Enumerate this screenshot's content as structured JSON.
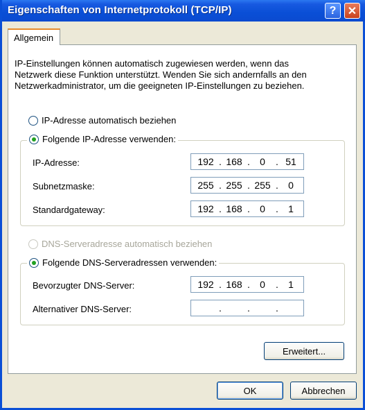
{
  "window": {
    "title": "Eigenschaften von Internetprotokoll (TCP/IP)",
    "help_label": "?",
    "close_label": "✕"
  },
  "tabs": [
    {
      "label": "Allgemein",
      "selected": true
    }
  ],
  "description": "IP-Einstellungen können automatisch zugewiesen werden, wenn das Netzwerk diese Funktion unterstützt. Wenden Sie sich andernfalls an den Netzwerkadministrator, um die geeigneten IP-Einstellungen zu beziehen.",
  "ip": {
    "auto_label": "IP-Adresse automatisch beziehen",
    "manual_label": "Folgende IP-Adresse verwenden:",
    "selected": "manual",
    "fields": [
      {
        "label": "IP-Adresse:",
        "octets": [
          "192",
          "168",
          "0",
          "51"
        ]
      },
      {
        "label": "Subnetzmaske:",
        "octets": [
          "255",
          "255",
          "255",
          "0"
        ]
      },
      {
        "label": "Standardgateway:",
        "octets": [
          "192",
          "168",
          "0",
          "1"
        ]
      }
    ]
  },
  "dns": {
    "auto_label": "DNS-Serveradresse automatisch beziehen",
    "auto_enabled": false,
    "manual_label": "Folgende DNS-Serveradressen verwenden:",
    "selected": "manual",
    "fields": [
      {
        "label": "Bevorzugter DNS-Server:",
        "octets": [
          "192",
          "168",
          "0",
          "1"
        ]
      },
      {
        "label": "Alternativer DNS-Server:",
        "octets": [
          "",
          "",
          "",
          ""
        ]
      }
    ]
  },
  "buttons": {
    "advanced": "Erweitert...",
    "ok": "OK",
    "cancel": "Abbrechen"
  },
  "colors": {
    "titlebar": "#0a4fd6",
    "face": "#ece9d8",
    "radio_checked": "#21a121",
    "tab_highlight": "#e68b2c"
  }
}
